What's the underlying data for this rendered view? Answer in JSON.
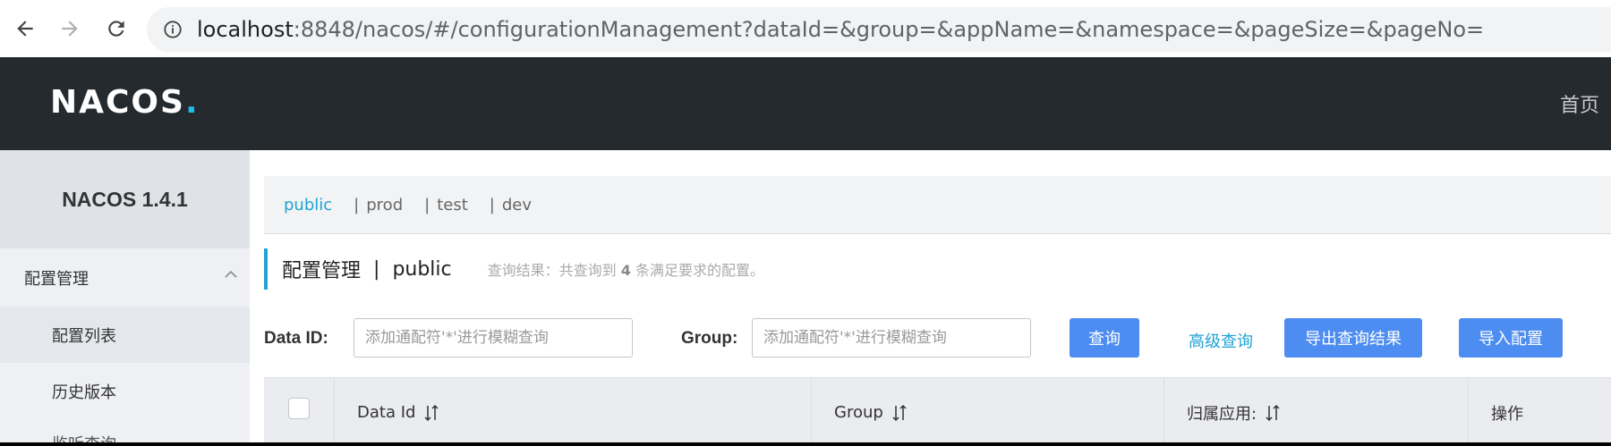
{
  "browser": {
    "url_host": "localhost",
    "url_rest": ":8848/nacos/#/configurationManagement?dataId=&group=&appName=&namespace=&pageSize=&pageNo="
  },
  "header": {
    "logo_main": "NACOS",
    "logo_dot": ".",
    "home_link": "首页"
  },
  "sidebar": {
    "title": "NACOS 1.4.1",
    "group_label": "配置管理",
    "items": [
      {
        "label": "配置列表"
      },
      {
        "label": "历史版本"
      },
      {
        "label": "监听查询"
      }
    ]
  },
  "namespaces": {
    "separator": "|",
    "items": [
      "public",
      "prod",
      "test",
      "dev"
    ]
  },
  "page": {
    "title": "配置管理",
    "divider": "|",
    "namespace": "public",
    "result_prefix": "查询结果：共查询到",
    "result_count": "4",
    "result_suffix": "条满足要求的配置。"
  },
  "query": {
    "dataid_label": "Data ID:",
    "dataid_placeholder": "添加通配符'*'进行模糊查询",
    "group_label": "Group:",
    "group_placeholder": "添加通配符'*'进行模糊查询",
    "search_button": "查询",
    "advanced_link": "高级查询",
    "export_button": "导出查询结果",
    "import_button": "导入配置"
  },
  "table": {
    "columns": [
      "Data Id",
      "Group",
      "归属应用:",
      "操作"
    ]
  },
  "colors": {
    "header_bg": "#252a2f",
    "accent": "#1fa3d4",
    "primary_button": "#4d8cf0"
  }
}
